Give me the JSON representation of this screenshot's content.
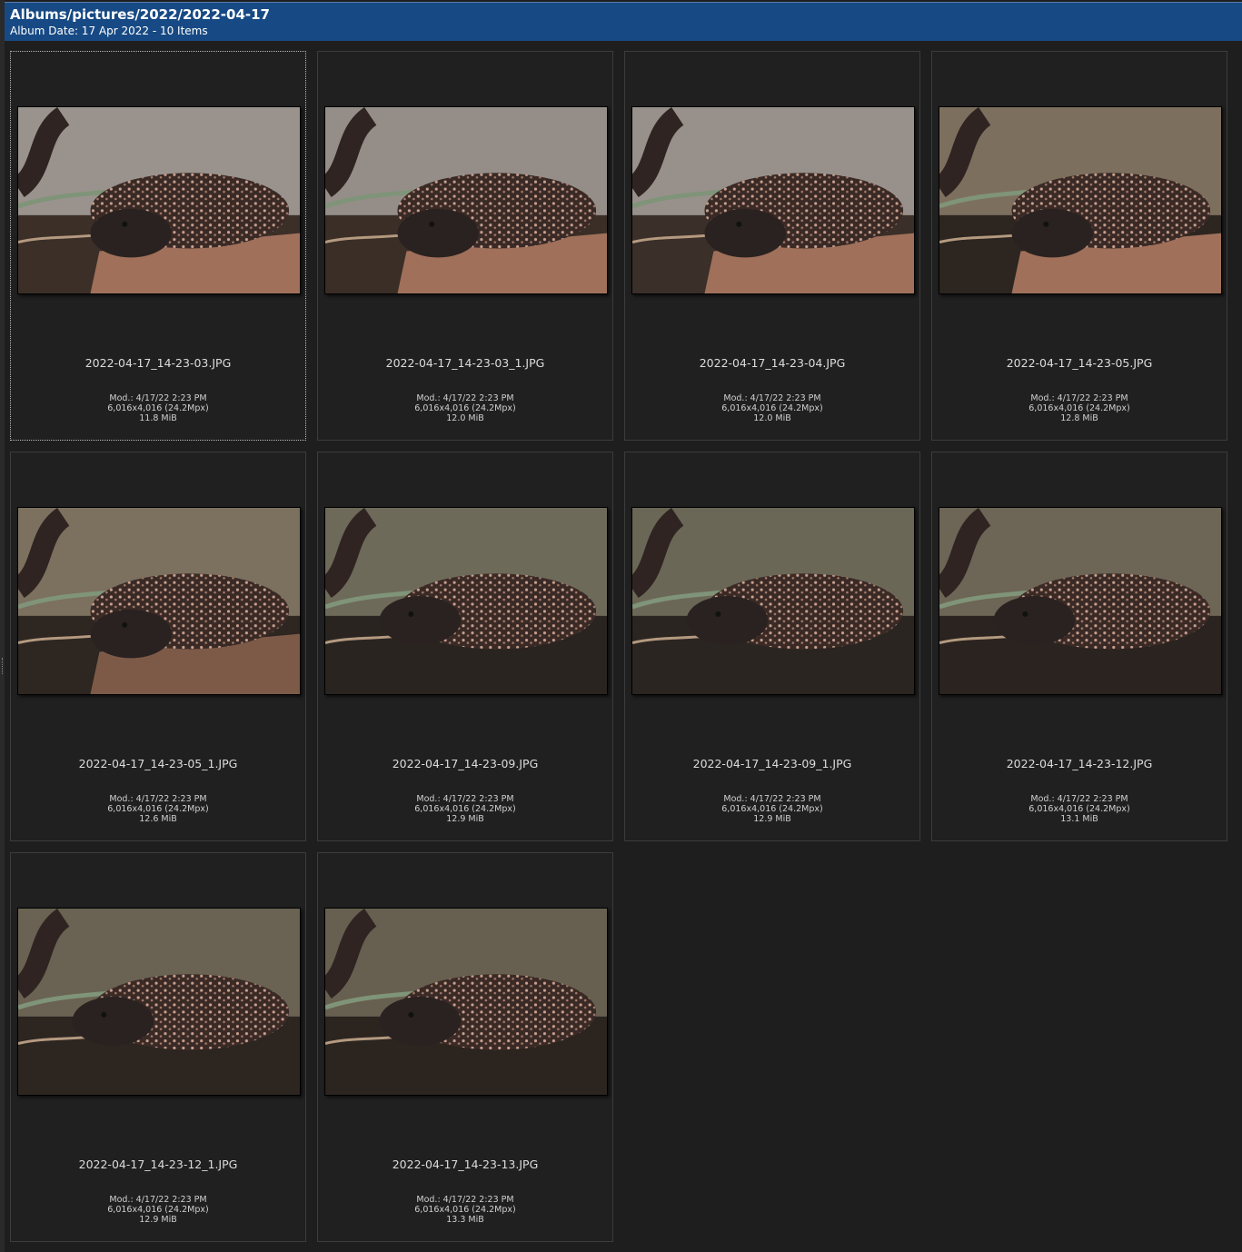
{
  "header": {
    "title": "Albums/pictures/2022/2022-04-17",
    "subtitle": "Album Date: 17 Apr 2022 - 10 Items"
  },
  "items": [
    {
      "filename": "2022-04-17_14-23-03.JPG",
      "modified": "Mod.: 4/17/22 2:23 PM",
      "dimensions": "6,016x4,016 (24.2Mpx)",
      "size": "11.8 MiB",
      "thumb_icon": "gila-monster-photo"
    },
    {
      "filename": "2022-04-17_14-23-03_1.JPG",
      "modified": "Mod.: 4/17/22 2:23 PM",
      "dimensions": "6,016x4,016 (24.2Mpx)",
      "size": "12.0 MiB",
      "thumb_icon": "gila-monster-photo"
    },
    {
      "filename": "2022-04-17_14-23-04.JPG",
      "modified": "Mod.: 4/17/22 2:23 PM",
      "dimensions": "6,016x4,016 (24.2Mpx)",
      "size": "12.0 MiB",
      "thumb_icon": "gila-monster-photo"
    },
    {
      "filename": "2022-04-17_14-23-05.JPG",
      "modified": "Mod.: 4/17/22 2:23 PM",
      "dimensions": "6,016x4,016 (24.2Mpx)",
      "size": "12.8 MiB",
      "thumb_icon": "gila-monster-photo"
    },
    {
      "filename": "2022-04-17_14-23-05_1.JPG",
      "modified": "Mod.: 4/17/22 2:23 PM",
      "dimensions": "6,016x4,016 (24.2Mpx)",
      "size": "12.6 MiB",
      "thumb_icon": "gila-monster-photo"
    },
    {
      "filename": "2022-04-17_14-23-09.JPG",
      "modified": "Mod.: 4/17/22 2:23 PM",
      "dimensions": "6,016x4,016 (24.2Mpx)",
      "size": "12.9 MiB",
      "thumb_icon": "gila-monster-photo"
    },
    {
      "filename": "2022-04-17_14-23-09_1.JPG",
      "modified": "Mod.: 4/17/22 2:23 PM",
      "dimensions": "6,016x4,016 (24.2Mpx)",
      "size": "12.9 MiB",
      "thumb_icon": "gila-monster-photo"
    },
    {
      "filename": "2022-04-17_14-23-12.JPG",
      "modified": "Mod.: 4/17/22 2:23 PM",
      "dimensions": "6,016x4,016 (24.2Mpx)",
      "size": "13.1 MiB",
      "thumb_icon": "gila-monster-photo"
    },
    {
      "filename": "2022-04-17_14-23-12_1.JPG",
      "modified": "Mod.: 4/17/22 2:23 PM",
      "dimensions": "6,016x4,016 (24.2Mpx)",
      "size": "12.9 MiB",
      "thumb_icon": "gila-monster-photo"
    },
    {
      "filename": "2022-04-17_14-23-13.JPG",
      "modified": "Mod.: 4/17/22 2:23 PM",
      "dimensions": "6,016x4,016 (24.2Mpx)",
      "size": "13.3 MiB",
      "thumb_icon": "gila-monster-photo"
    }
  ],
  "colors": {
    "header_bg": "#174a84",
    "view_bg": "#1e1e1e",
    "tile_border": "#3c3c3c",
    "text": "#dcdcdc"
  }
}
